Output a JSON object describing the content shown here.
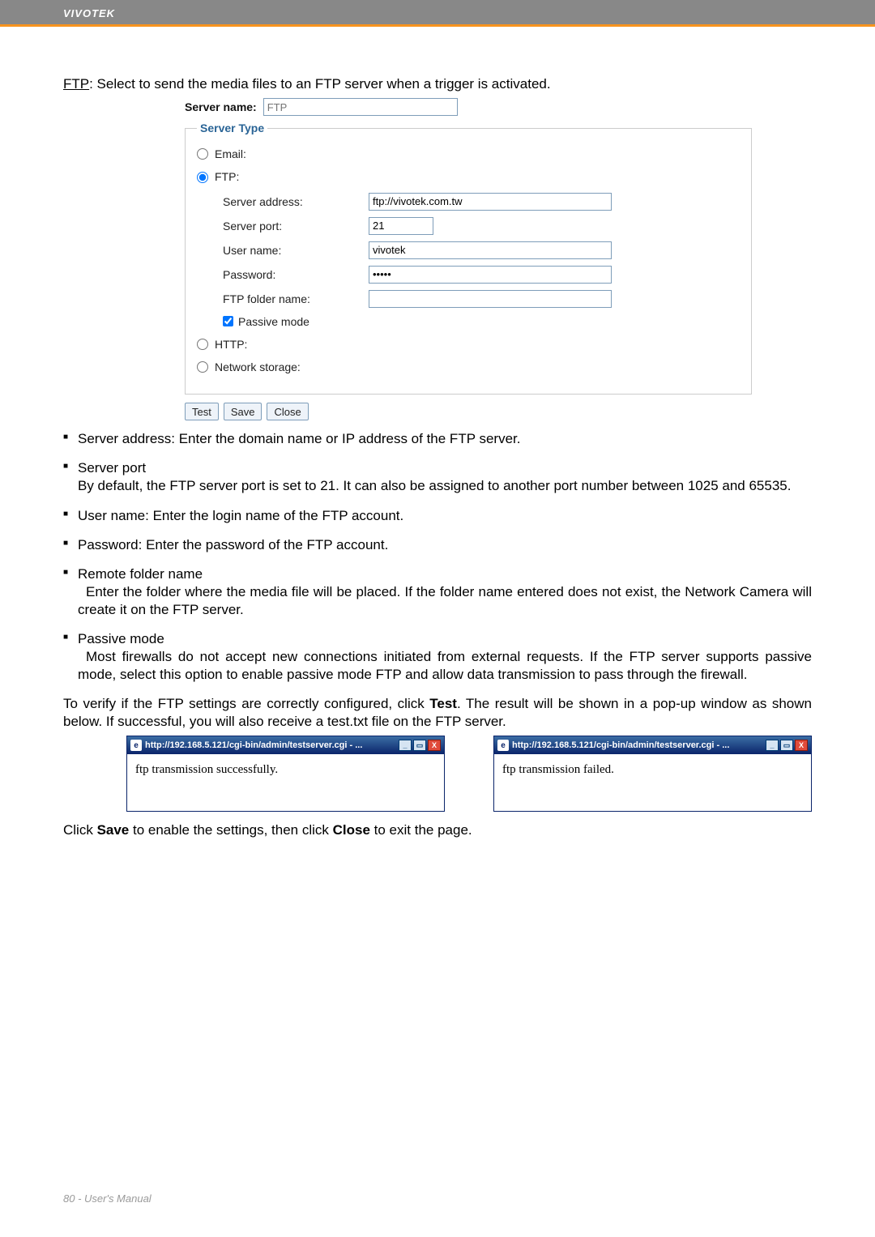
{
  "header": {
    "brand": "VIVOTEK"
  },
  "intro": {
    "ftp_label": "FTP",
    "text": ": Select to send the media files to an FTP server when a trigger is activated."
  },
  "server_name": {
    "label": "Server name:",
    "placeholder": "FTP"
  },
  "server_type": {
    "legend": "Server Type",
    "email_label": "Email:",
    "ftp_label": "FTP:",
    "fields": {
      "address_label": "Server address:",
      "address_value": "ftp://vivotek.com.tw",
      "port_label": "Server port:",
      "port_value": "21",
      "user_label": "User name:",
      "user_value": "vivotek",
      "pass_label": "Password:",
      "pass_value": "•••••",
      "folder_label": "FTP folder name:",
      "folder_value": "",
      "passive_label": "Passive mode"
    },
    "http_label": "HTTP:",
    "ns_label": "Network storage:"
  },
  "buttons": {
    "test": "Test",
    "save": "Save",
    "close": "Close"
  },
  "bullets": {
    "b1": "Server address: Enter the domain name or IP address of the FTP server.",
    "b2_title": "Server port",
    "b2_body": "By default, the FTP server port is set to 21. It can also be assigned to another port number between 1025 and 65535.",
    "b3": "User name: Enter the login name of the FTP account.",
    "b4": "Password: Enter the password of the FTP account.",
    "b5_title": "Remote folder name",
    "b5_body": "Enter the folder where the media file will be placed. If the folder name entered does not exist, the Network Camera will create it on the FTP server.",
    "b6_title": "Passive mode",
    "b6_body": "Most firewalls do not accept new connections initiated from external requests. If the FTP server supports passive mode, select this option to enable passive mode FTP and allow data transmission to pass through the firewall."
  },
  "verify": {
    "pre": "To verify if the FTP settings are correctly configured, click ",
    "bold": "Test",
    "post": ". The result will be shown in a pop-up window as shown below. If successful, you will also receive a test.txt file on the FTP server."
  },
  "popups": {
    "title": "http://192.168.5.121/cgi-bin/admin/testserver.cgi - ...",
    "success": "ftp transmission successfully.",
    "failed": "ftp transmission failed."
  },
  "final": {
    "pre": "Click ",
    "save": "Save",
    "mid": " to enable the settings, then click ",
    "close": "Close",
    "post": " to exit the page."
  },
  "footer": {
    "page": "80 - User's Manual"
  }
}
